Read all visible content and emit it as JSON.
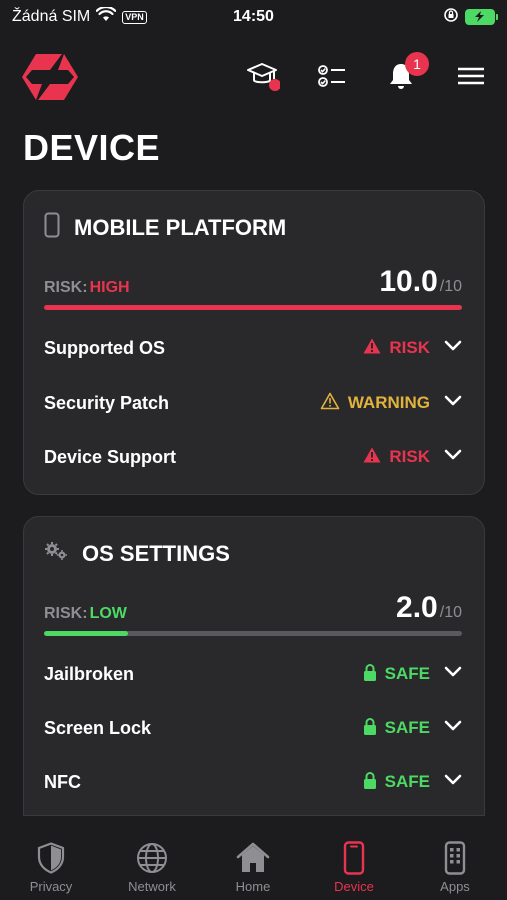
{
  "status_bar": {
    "carrier": "Žádná SIM",
    "vpn": "VPN",
    "time": "14:50"
  },
  "header": {
    "notification_count": "1"
  },
  "page_title": "DEVICE",
  "cards": [
    {
      "title": "MOBILE PLATFORM",
      "risk_label": "RISK:",
      "risk_level": "HIGH",
      "score": "10.0",
      "score_max": "/10",
      "score_fraction": 1.0,
      "checks": [
        {
          "name": "Supported OS",
          "status": "RISK"
        },
        {
          "name": "Security Patch",
          "status": "WARNING"
        },
        {
          "name": "Device Support",
          "status": "RISK"
        }
      ]
    },
    {
      "title": "OS SETTINGS",
      "risk_label": "RISK:",
      "risk_level": "LOW",
      "score": "2.0",
      "score_max": "/10",
      "score_fraction": 0.2,
      "checks": [
        {
          "name": "Jailbroken",
          "status": "SAFE"
        },
        {
          "name": "Screen Lock",
          "status": "SAFE"
        },
        {
          "name": "NFC",
          "status": "SAFE"
        }
      ]
    }
  ],
  "tabs": [
    {
      "label": "Privacy",
      "icon": "shield-icon"
    },
    {
      "label": "Network",
      "icon": "globe-icon"
    },
    {
      "label": "Home",
      "icon": "home-icon"
    },
    {
      "label": "Device",
      "icon": "phone-icon",
      "active": true
    },
    {
      "label": "Apps",
      "icon": "apps-icon"
    }
  ],
  "colors": {
    "accent": "#e8344e",
    "safe": "#4cd964",
    "warning": "#e3b23c",
    "background": "#1c1c1e",
    "card": "#29292c"
  }
}
